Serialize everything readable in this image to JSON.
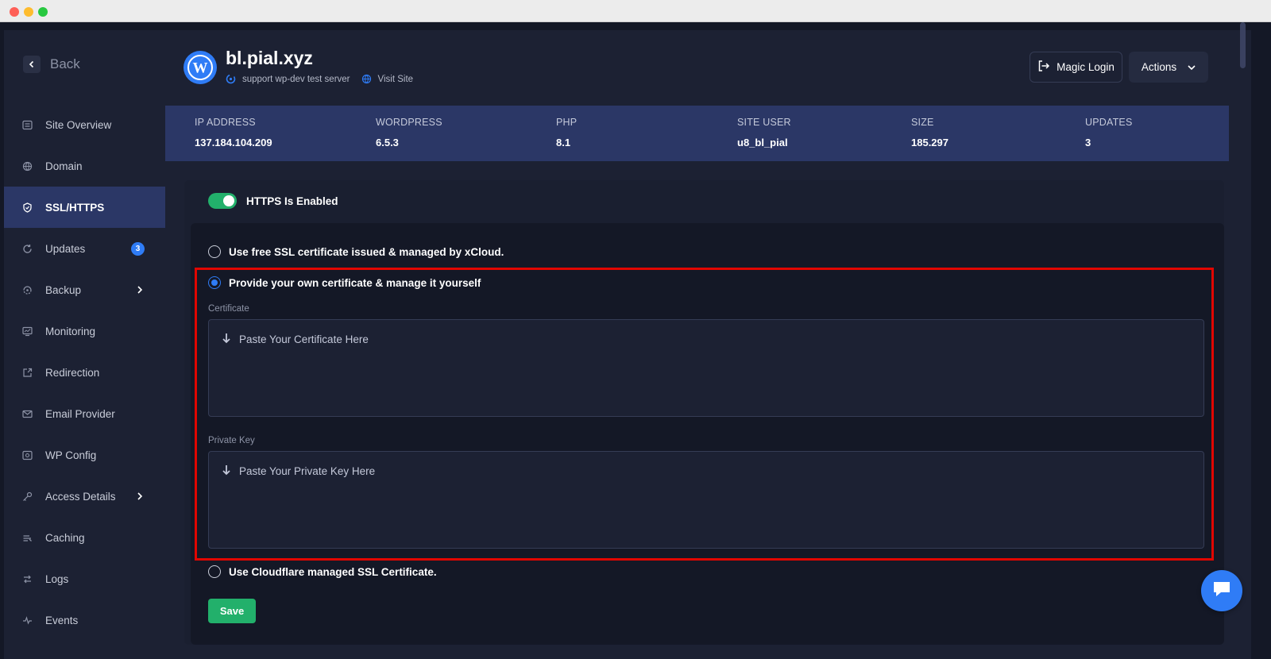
{
  "sidebar": {
    "back_label": "Back",
    "items": [
      {
        "label": "Site Overview",
        "icon": "overview-icon"
      },
      {
        "label": "Domain",
        "icon": "domain-icon"
      },
      {
        "label": "SSL/HTTPS",
        "icon": "shield-icon",
        "active": true
      },
      {
        "label": "Updates",
        "icon": "refresh-icon",
        "badge": "3"
      },
      {
        "label": "Backup",
        "icon": "backup-icon",
        "chevron": true
      },
      {
        "label": "Monitoring",
        "icon": "monitor-icon"
      },
      {
        "label": "Redirection",
        "icon": "redirect-icon"
      },
      {
        "label": "Email Provider",
        "icon": "mail-icon"
      },
      {
        "label": "WP Config",
        "icon": "config-icon"
      },
      {
        "label": "Access Details",
        "icon": "key-icon",
        "chevron": true
      },
      {
        "label": "Caching",
        "icon": "cache-icon"
      },
      {
        "label": "Logs",
        "icon": "logs-icon"
      },
      {
        "label": "Events",
        "icon": "pulse-icon"
      }
    ]
  },
  "header": {
    "site_name": "bl.pial.xyz",
    "server_label": "support wp-dev test server",
    "visit_label": "Visit Site",
    "magic_login_label": "Magic Login",
    "actions_label": "Actions"
  },
  "stats": [
    {
      "label": "IP ADDRESS",
      "value": "137.184.104.209"
    },
    {
      "label": "WORDPRESS",
      "value": "6.5.3"
    },
    {
      "label": "PHP",
      "value": "8.1"
    },
    {
      "label": "SITE USER",
      "value": "u8_bl_pial"
    },
    {
      "label": "SIZE",
      "value": "185.297"
    },
    {
      "label": "UPDATES",
      "value": "3"
    }
  ],
  "ssl": {
    "toggle_label": "HTTPS Is Enabled",
    "toggle_on": true,
    "option_free": "Use free SSL certificate issued & managed by xCloud.",
    "option_own": "Provide your own certificate & manage it yourself",
    "option_cloudflare": "Use Cloudflare managed SSL Certificate.",
    "selected_option": "own",
    "certificate_label": "Certificate",
    "certificate_placeholder": "Paste Your Certificate Here",
    "private_key_label": "Private Key",
    "private_key_placeholder": "Paste Your Private Key Here",
    "save_label": "Save"
  },
  "colors": {
    "accent": "#2f7cf6",
    "success": "#22b06b",
    "active_nav": "#2b3766",
    "highlight": "#e10600"
  }
}
